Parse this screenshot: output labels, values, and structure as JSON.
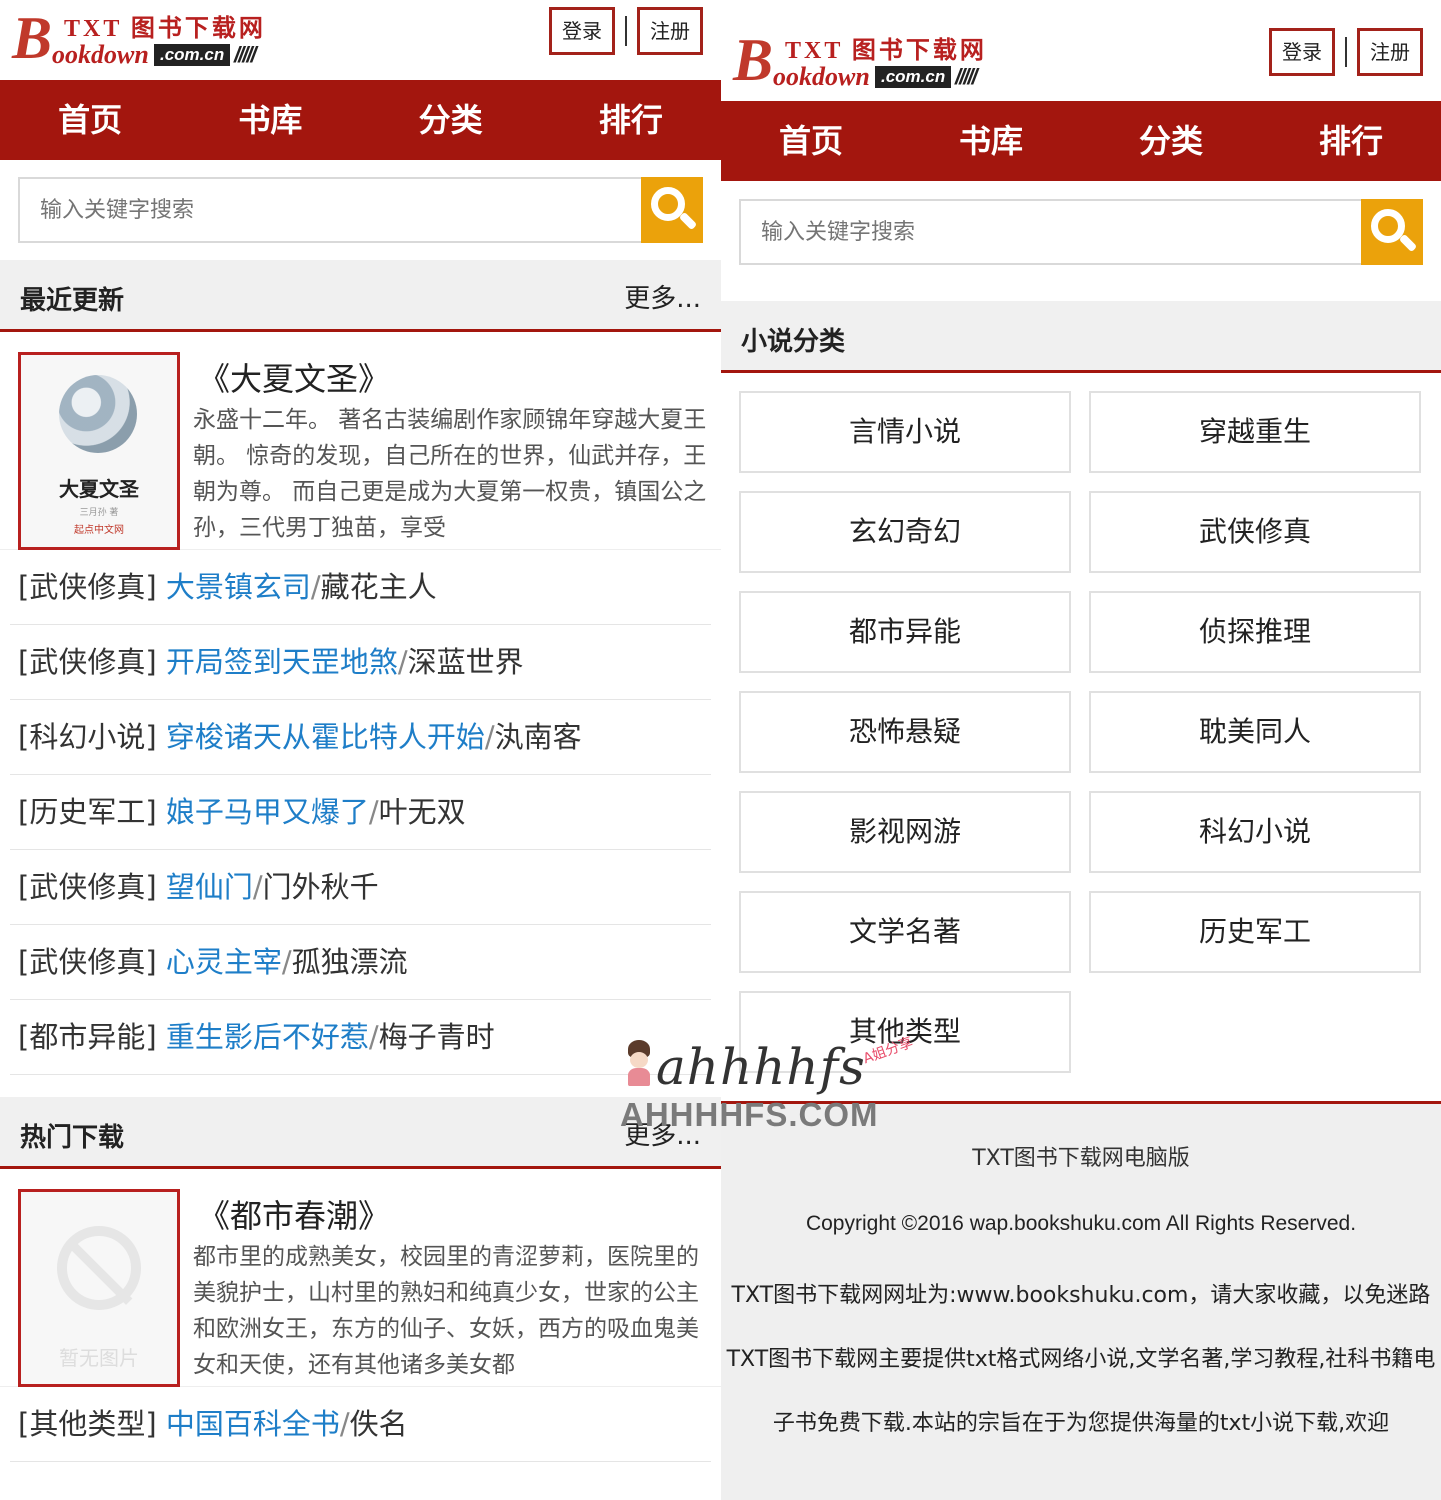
{
  "brand": {
    "big_letter": "B",
    "txt_label": "TXT 图书下载网",
    "sub_label": "ookdown",
    "domain_label": ".com.cn",
    "bars": "/////"
  },
  "auth": {
    "login_label": "登录",
    "register_label": "注册"
  },
  "nav": {
    "items": [
      {
        "label": "首页"
      },
      {
        "label": "书库"
      },
      {
        "label": "分类"
      },
      {
        "label": "排行"
      }
    ]
  },
  "search": {
    "placeholder": "输入关键字搜索",
    "value": ""
  },
  "recent": {
    "title": "最近更新",
    "more_label": "更多...",
    "featured": {
      "title": "《大夏文圣》",
      "cover_title": "大夏文圣",
      "cover_author": "三月孙 著",
      "cover_publisher": "起点中文网",
      "description": "永盛十二年。 著名古装编剧作家顾锦年穿越大夏王朝。 惊奇的发现，自己所在的世界，仙武并存，王朝为尊。 而自己更是成为大夏第一权贵，镇国公之孙，三代男丁独苗，享受"
    },
    "items": [
      {
        "category": "[武侠修真]",
        "name": "大景镇玄司",
        "author": "藏花主人"
      },
      {
        "category": "[武侠修真]",
        "name": "开局签到天罡地煞",
        "author": "深蓝世界"
      },
      {
        "category": "[科幻小说]",
        "name": "穿梭诸天从霍比特人开始",
        "author": "汍南客"
      },
      {
        "category": "[历史军工]",
        "name": "娘子马甲又爆了",
        "author": "叶无双"
      },
      {
        "category": "[武侠修真]",
        "name": "望仙门",
        "author": "门外秋千"
      },
      {
        "category": "[武侠修真]",
        "name": "心灵主宰",
        "author": "孤独漂流"
      },
      {
        "category": "[都市异能]",
        "name": "重生影后不好惹",
        "author": "梅子青时"
      }
    ]
  },
  "hot": {
    "title": "热门下载",
    "more_label": "更多...",
    "featured": {
      "title": "《都市春潮》",
      "no_image_label": "暂无图片",
      "description": "都市里的成熟美女，校园里的青涩萝莉，医院里的美貌护士，山村里的熟妇和纯真少女，世家的公主和欧洲女王，东方的仙子、女妖，西方的吸血鬼美女和天使，还有其他诸多美女都"
    },
    "items": [
      {
        "category": "[其他类型]",
        "name": "中国百科全书",
        "author": "佚名"
      }
    ]
  },
  "categories": {
    "title": "小说分类",
    "items": [
      "言情小说",
      "穿越重生",
      "玄幻奇幻",
      "武侠修真",
      "都市异能",
      "侦探推理",
      "恐怖悬疑",
      "耽美同人",
      "影视网游",
      "科幻小说",
      "文学名著",
      "历史军工",
      "其他类型"
    ]
  },
  "footer": {
    "pc_version": "TXT图书下载网电脑版",
    "copyright": "Copyright ©2016 wap.bookshuku.com All Rights Reserved.",
    "address_note": "TXT图书下载网网址为:www.bookshuku.com，请大家收藏，以免迷路",
    "about": "TXT图书下载网主要提供txt格式网络小说,文学名著,学习教程,社科书籍电子书免费下载.本站的宗旨在于为您提供海量的txt小说下载,欢迎"
  },
  "watermark": {
    "script": "ahhhhfs",
    "tag": "A姐分享",
    "domain": "AHHHHFS.COM"
  },
  "colors": {
    "brand_red": "#a3160e",
    "search_orange": "#eba20b",
    "link_blue": "#1e7ec8"
  }
}
